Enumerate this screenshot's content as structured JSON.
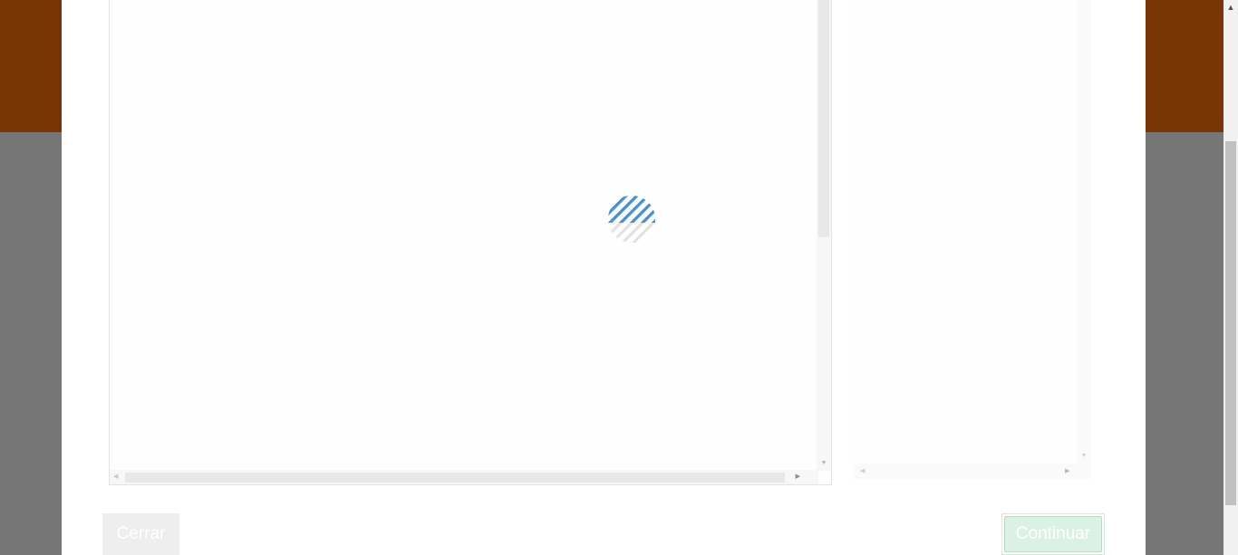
{
  "modal": {
    "buttons": {
      "close_label": "Cerrar",
      "continue_label": "Continuar"
    },
    "viewer": {
      "state": "loading",
      "spinner_icon": "striped-loading-icon"
    }
  },
  "colors": {
    "header_background": "#7a3507",
    "overlay": "#767676",
    "spinner_primary": "#4a8fd0",
    "spinner_secondary": "#e2e2e2",
    "continue_button": "#dcf1e5"
  }
}
